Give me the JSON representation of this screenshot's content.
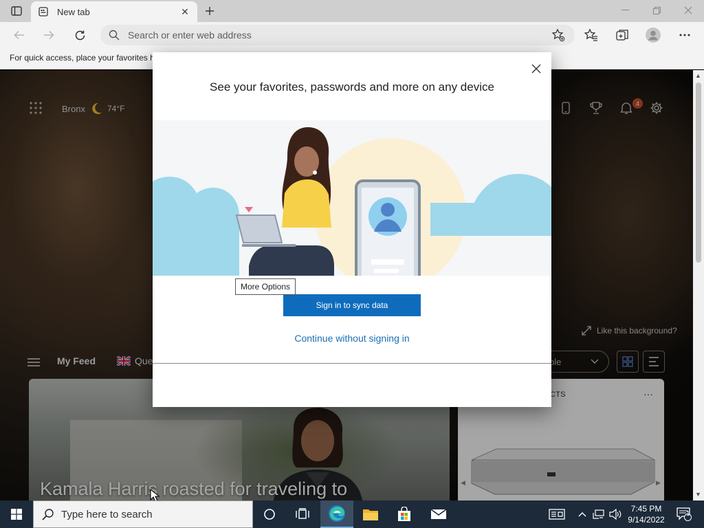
{
  "browser": {
    "tab": {
      "title": "New tab"
    },
    "address_placeholder": "Search or enter web address",
    "favorites_bar_text": "For quick access, place your favorites h"
  },
  "ntp": {
    "weather": {
      "location": "Bronx",
      "temperature": "74°F"
    },
    "notification_count": "4",
    "like_background": "Like this background?",
    "feed_tabs": [
      "My Feed",
      "Que"
    ],
    "layout_select_value": "ble",
    "headline": "Kamala Harris roasted for traveling to",
    "side_card_label": "CTS",
    "side_card_more": "···"
  },
  "modal": {
    "title": "See your favorites, passwords and more on any device",
    "primary_button": "Sign in to sync data",
    "secondary_link": "Continue without signing in"
  },
  "tooltip": "More Options",
  "taskbar": {
    "search_placeholder": "Type here to search",
    "time": "7:45 PM",
    "date": "9/14/2022",
    "notification_count": "1"
  },
  "colors": {
    "primary_button": "#0f6cbd",
    "link": "#1a6fb5",
    "taskbar": "#1c2a3a",
    "notif_badge": "#c94f2b"
  }
}
